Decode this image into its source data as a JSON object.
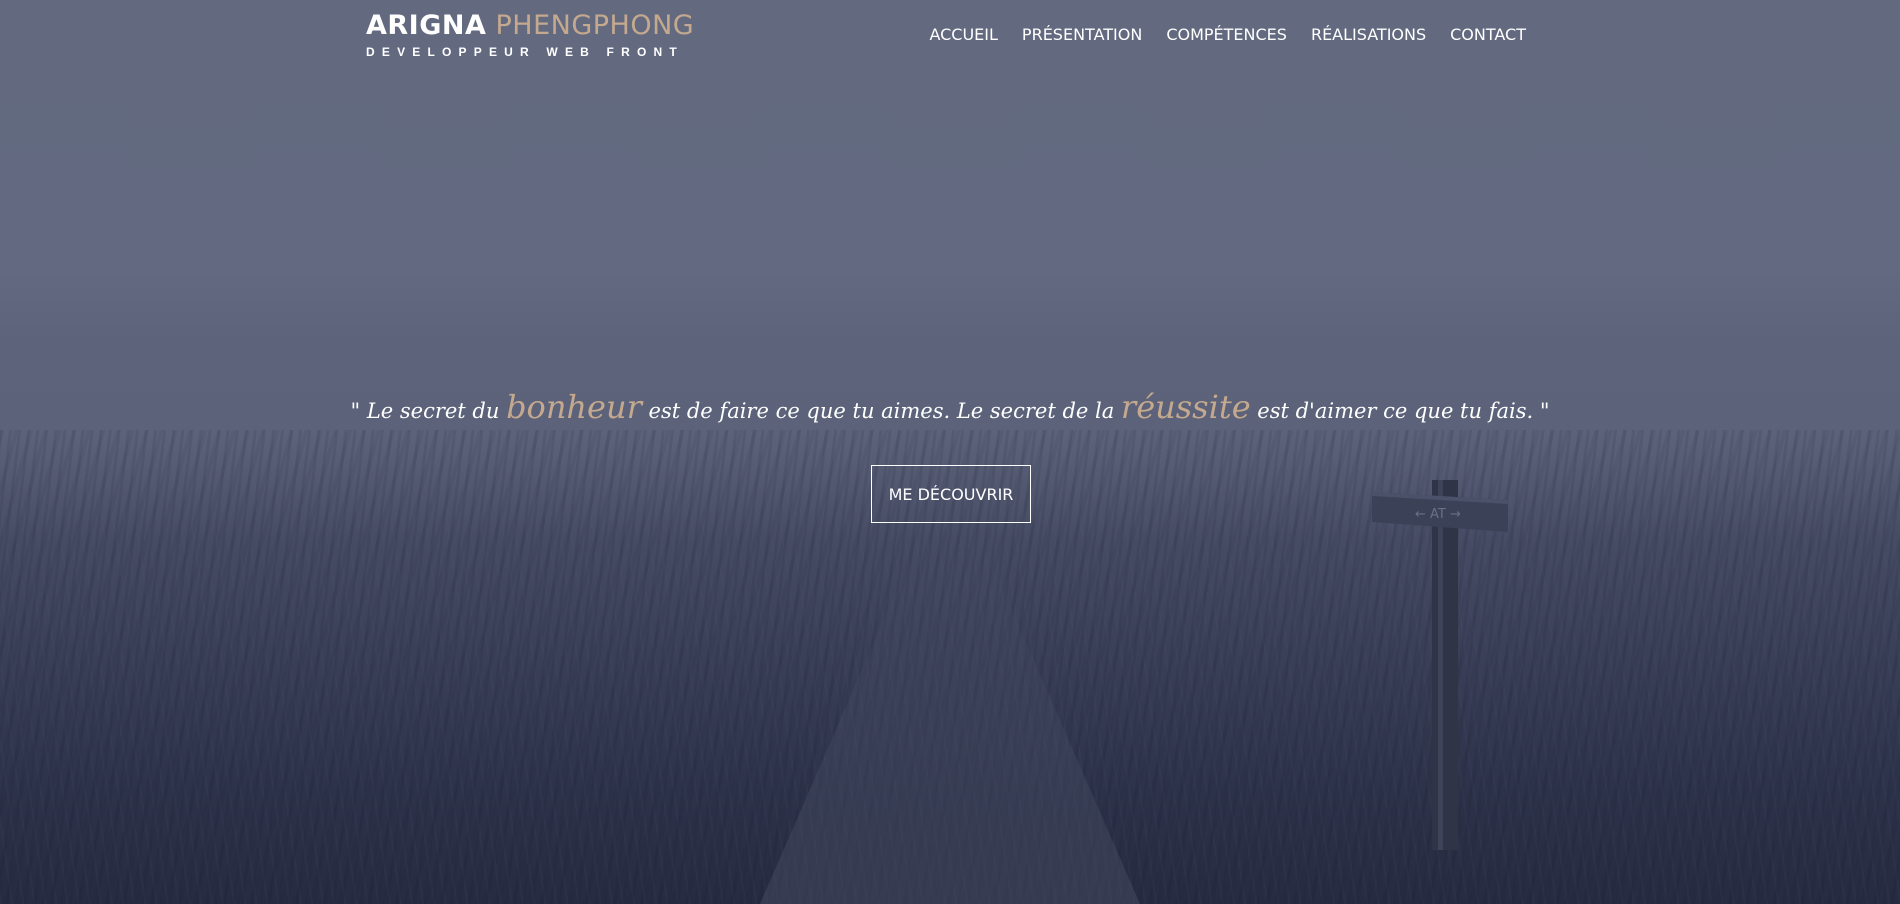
{
  "header": {
    "brand_first": "ARIGNA",
    "brand_last": "PHENGPHONG",
    "tagline": "DEVELOPPEUR WEB FRONT"
  },
  "nav": {
    "items": [
      {
        "label": "ACCUEIL"
      },
      {
        "label": "PRÉSENTATION"
      },
      {
        "label": "COMPÉTENCES"
      },
      {
        "label": "RÉALISATIONS"
      },
      {
        "label": "CONTACT"
      }
    ]
  },
  "hero": {
    "quote": {
      "part1": "\" Le secret du ",
      "accent1": "bonheur",
      "part2": " est de faire ce que tu aimes. Le secret de la ",
      "accent2": "réussite",
      "part3": " est d'aimer ce que tu fais. \""
    },
    "cta_label": "ME DÉCOUVRIR"
  },
  "colors": {
    "accent": "#c4a98e",
    "text": "#ffffff",
    "overlay": "#3a4058"
  },
  "icons": {
    "background": "misty-grass-path-photo",
    "signpost": "wooden-signpost-icon"
  }
}
